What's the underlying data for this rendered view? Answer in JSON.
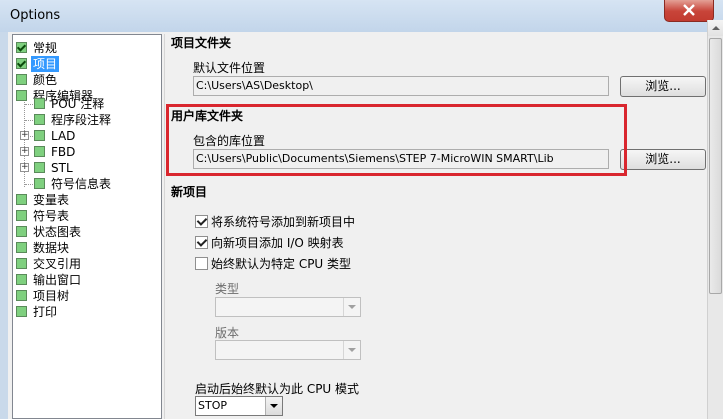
{
  "window": {
    "title": "Options"
  },
  "tree": {
    "items": [
      {
        "label": "常规",
        "checked": true
      },
      {
        "label": "项目",
        "checked": true,
        "selected": true
      },
      {
        "label": "颜色",
        "checked": false
      },
      {
        "label": "程序编辑器",
        "checked": false
      },
      {
        "label": "POU 注释",
        "checked": false
      },
      {
        "label": "程序段注释",
        "checked": false
      },
      {
        "label": "LAD",
        "checked": false,
        "expandable": true
      },
      {
        "label": "FBD",
        "checked": false,
        "expandable": true
      },
      {
        "label": "STL",
        "checked": false,
        "expandable": true
      },
      {
        "label": "符号信息表",
        "checked": false
      },
      {
        "label": "变量表",
        "checked": false
      },
      {
        "label": "符号表",
        "checked": false
      },
      {
        "label": "状态图表",
        "checked": false
      },
      {
        "label": "数据块",
        "checked": false
      },
      {
        "label": "交叉引用",
        "checked": false
      },
      {
        "label": "输出窗口",
        "checked": false
      },
      {
        "label": "项目树",
        "checked": false
      },
      {
        "label": "打印",
        "checked": false
      }
    ],
    "expander_symbol": "+"
  },
  "project_folder": {
    "header": "项目文件夹",
    "default_location_label": "默认文件位置",
    "default_location_value": "C:\\Users\\AS\\Desktop\\",
    "browse_label": "浏览..."
  },
  "library_folder": {
    "header": "用户库文件夹",
    "location_label": "包含的库位置",
    "location_value": "C:\\Users\\Public\\Documents\\Siemens\\STEP 7-MicroWIN SMART\\Lib",
    "browse_label": "浏览..."
  },
  "new_project": {
    "header": "新项目",
    "option_add_symbols": {
      "label": "将系统符号添加到新项目中",
      "checked": true
    },
    "option_add_io": {
      "label": "向新项目添加 I/O 映射表",
      "checked": true
    },
    "option_default_cpu": {
      "label": "始终默认为特定 CPU 类型",
      "checked": false
    },
    "type_label": "类型",
    "version_label": "版本",
    "startup_mode_label": "启动后始终默认为此 CPU 模式",
    "startup_mode_value": "STOP"
  },
  "colors": {
    "highlight_border": "#d9262e",
    "selection": "#3399ff",
    "tree_checkbox": "#7fd07f"
  }
}
